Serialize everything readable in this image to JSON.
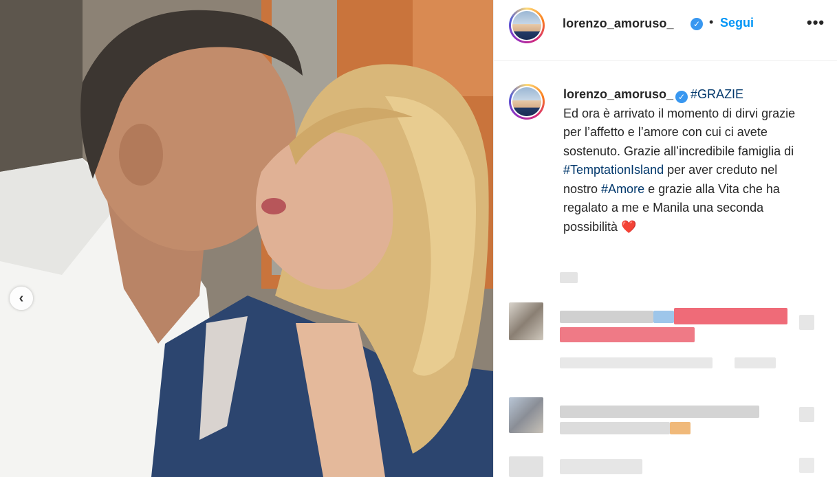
{
  "post": {
    "username": "lorenzo_amoruso_",
    "verified_mark": "✓",
    "follow_separator": "•",
    "follow_label": "Segui",
    "more_label": "•••",
    "carousel_prev_label": "‹"
  },
  "caption": {
    "username": "lorenzo_amoruso_",
    "hashtag_1": "#GRAZIE",
    "text_1": "Ed ora è arrivato il momento di dirvi grazie per l’affetto e l’amore con cui ci avete sostenuto. Grazie all’incredibile famiglia di",
    "hashtag_2": "#TemptationIsland",
    "text_2": "per aver creduto nel nostro",
    "hashtag_3": "#Amore",
    "text_3": "e grazie alla Vita che ha regalato a me e Manila una seconda possibilità",
    "heart": "❤️"
  },
  "colors": {
    "link": "#0095f6",
    "hashtag": "#00376b",
    "verified": "#3897f0",
    "text": "#262626"
  },
  "icons": {
    "verified": "verified-badge-icon",
    "more": "more-options-icon",
    "carousel": "chevron-left-icon"
  }
}
